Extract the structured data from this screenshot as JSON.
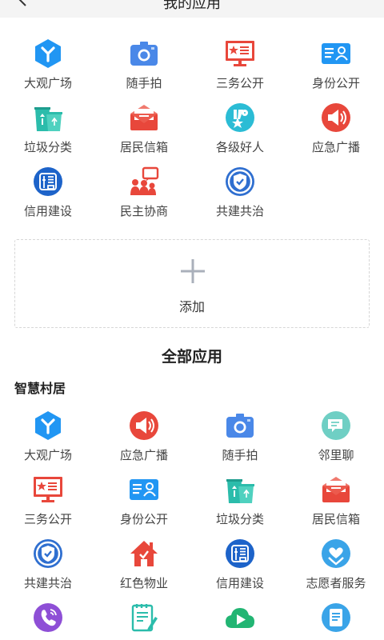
{
  "header": {
    "title": "我的应用"
  },
  "my_apps": [
    {
      "label": "大观广场",
      "icon": "da-guan-icon"
    },
    {
      "label": "随手拍",
      "icon": "camera-icon"
    },
    {
      "label": "三务公开",
      "icon": "board-star-icon"
    },
    {
      "label": "身份公开",
      "icon": "id-card-icon"
    },
    {
      "label": "垃圾分类",
      "icon": "trash-bins-icon"
    },
    {
      "label": "居民信箱",
      "icon": "mail-envelope-icon"
    },
    {
      "label": "各级好人",
      "icon": "good-person-icon"
    },
    {
      "label": "应急广播",
      "icon": "megaphone-icon"
    },
    {
      "label": "信用建设",
      "icon": "credit-icon"
    },
    {
      "label": "民主协商",
      "icon": "discussion-icon"
    },
    {
      "label": "共建共治",
      "icon": "shield-check-icon"
    }
  ],
  "add": {
    "label": "添加",
    "icon": "plus-icon"
  },
  "section_title": "全部应用",
  "category": {
    "title": "智慧村居"
  },
  "all_apps": [
    {
      "label": "大观广场",
      "icon": "da-guan-icon"
    },
    {
      "label": "应急广播",
      "icon": "megaphone-icon"
    },
    {
      "label": "随手拍",
      "icon": "camera-icon"
    },
    {
      "label": "邻里聊",
      "icon": "chat-bubble-icon"
    },
    {
      "label": "三务公开",
      "icon": "board-star-icon"
    },
    {
      "label": "身份公开",
      "icon": "id-card-icon"
    },
    {
      "label": "垃圾分类",
      "icon": "trash-bins-icon"
    },
    {
      "label": "居民信箱",
      "icon": "mail-envelope-icon"
    },
    {
      "label": "共建共治",
      "icon": "shield-check-icon"
    },
    {
      "label": "红色物业",
      "icon": "red-house-icon"
    },
    {
      "label": "信用建设",
      "icon": "credit-icon"
    },
    {
      "label": "志愿者服务",
      "icon": "volunteer-icon"
    },
    {
      "label": "",
      "icon": "phone-icon"
    },
    {
      "label": "",
      "icon": "notepad-icon"
    },
    {
      "label": "",
      "icon": "cloud-play-icon"
    },
    {
      "label": "",
      "icon": "document-icon"
    }
  ],
  "colors": {
    "blue": "#2196f3",
    "red": "#e8473b",
    "teal": "#2bbcab",
    "purple": "#8e4fd6",
    "header_bg": "#f4f4f4"
  }
}
